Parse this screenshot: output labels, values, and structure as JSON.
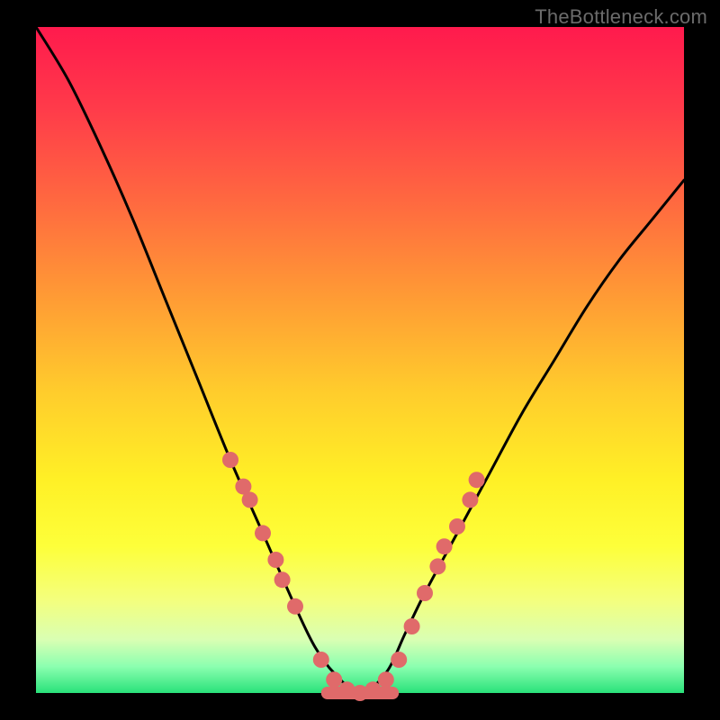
{
  "watermark": "TheBottleneck.com",
  "chart_data": {
    "type": "line",
    "title": "",
    "xlabel": "",
    "ylabel": "",
    "xlim": [
      0,
      1
    ],
    "ylim": [
      0,
      1
    ],
    "series": [
      {
        "name": "bottleneck-curve",
        "x": [
          0.0,
          0.05,
          0.1,
          0.15,
          0.2,
          0.25,
          0.3,
          0.35,
          0.4,
          0.43,
          0.46,
          0.5,
          0.54,
          0.57,
          0.6,
          0.65,
          0.7,
          0.75,
          0.8,
          0.85,
          0.9,
          0.95,
          1.0
        ],
        "y": [
          1.0,
          0.92,
          0.82,
          0.71,
          0.59,
          0.47,
          0.35,
          0.24,
          0.13,
          0.07,
          0.03,
          0.0,
          0.03,
          0.09,
          0.15,
          0.24,
          0.33,
          0.42,
          0.5,
          0.58,
          0.65,
          0.71,
          0.77
        ]
      }
    ],
    "markers": {
      "name": "highlight-dots",
      "color": "#e06a6a",
      "points": [
        {
          "x": 0.3,
          "y": 0.35
        },
        {
          "x": 0.32,
          "y": 0.31
        },
        {
          "x": 0.33,
          "y": 0.29
        },
        {
          "x": 0.35,
          "y": 0.24
        },
        {
          "x": 0.37,
          "y": 0.2
        },
        {
          "x": 0.38,
          "y": 0.17
        },
        {
          "x": 0.4,
          "y": 0.13
        },
        {
          "x": 0.44,
          "y": 0.05
        },
        {
          "x": 0.46,
          "y": 0.02
        },
        {
          "x": 0.48,
          "y": 0.005
        },
        {
          "x": 0.5,
          "y": 0.0
        },
        {
          "x": 0.52,
          "y": 0.005
        },
        {
          "x": 0.54,
          "y": 0.02
        },
        {
          "x": 0.56,
          "y": 0.05
        },
        {
          "x": 0.58,
          "y": 0.1
        },
        {
          "x": 0.6,
          "y": 0.15
        },
        {
          "x": 0.62,
          "y": 0.19
        },
        {
          "x": 0.63,
          "y": 0.22
        },
        {
          "x": 0.65,
          "y": 0.25
        },
        {
          "x": 0.67,
          "y": 0.29
        },
        {
          "x": 0.68,
          "y": 0.32
        }
      ]
    },
    "bottom_bar": {
      "color": "#e06a6a",
      "x0": 0.44,
      "x1": 0.56,
      "y": 0.0,
      "thickness_px": 14
    }
  }
}
